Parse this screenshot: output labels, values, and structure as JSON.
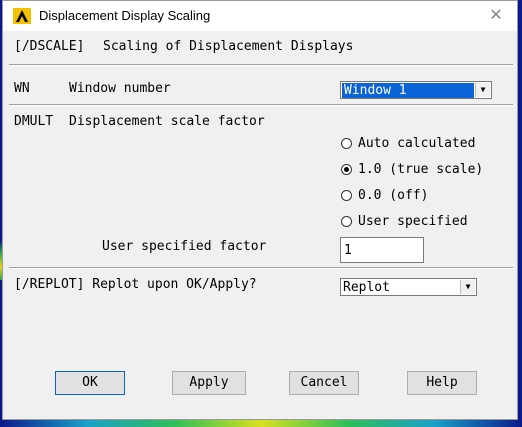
{
  "window": {
    "title": "Displacement Display Scaling",
    "close_glyph": "✕"
  },
  "header": {
    "command": "[/DSCALE]",
    "description": "Scaling of Displacement Displays"
  },
  "wn": {
    "code": "WN",
    "label": "Window number",
    "selected": "Window 1"
  },
  "dmult": {
    "code": "DMULT",
    "label": "Displacement scale factor",
    "options": [
      {
        "label": "Auto calculated",
        "selected": false
      },
      {
        "label": "1.0 (true scale)",
        "selected": true
      },
      {
        "label": "0.0 (off)",
        "selected": false
      },
      {
        "label": "User specified",
        "selected": false
      }
    ],
    "user_factor_label": "User specified factor",
    "user_factor_value": "1"
  },
  "replot": {
    "label": "[/REPLOT] Replot upon OK/Apply?",
    "selected": "Replot"
  },
  "buttons": {
    "ok": "OK",
    "apply": "Apply",
    "cancel": "Cancel",
    "help": "Help"
  },
  "colors": {
    "accent": "#0a64d8",
    "icon": "#f2c200"
  }
}
